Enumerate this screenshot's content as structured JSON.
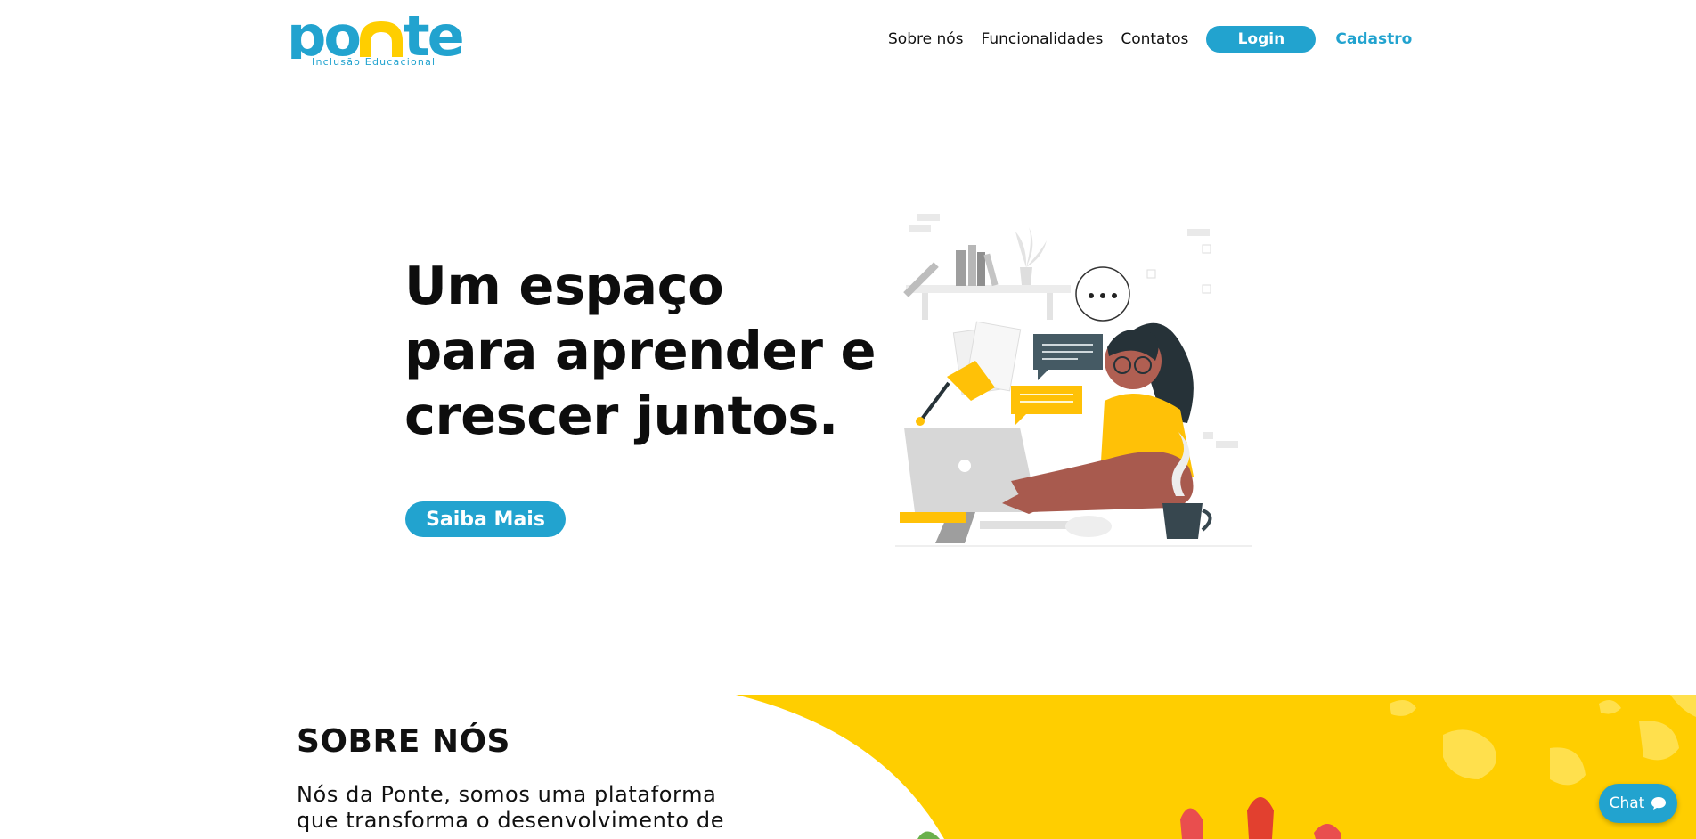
{
  "header": {
    "logo_text": "ponte",
    "logo_subtitle": "Inclusão Educacional",
    "nav": {
      "sobre": "Sobre nós",
      "funcionalidades": "Funcionalidades",
      "contatos": "Contatos",
      "login": "Login",
      "cadastro": "Cadastro"
    }
  },
  "hero": {
    "title_lines": [
      "Um espaço",
      "para aprender e",
      "crescer juntos."
    ],
    "cta": "Saiba Mais",
    "illustration": "woman-at-computer-illustration"
  },
  "about": {
    "title": "SOBRE NÓS",
    "text_lines": [
      "Nós da Ponte, somos uma plataforma",
      "que transforma o desenvolvimento de"
    ]
  },
  "chat": {
    "label": "Chat",
    "icon": "chat-bubble-icon"
  },
  "colors": {
    "primary": "#22a3cf",
    "accent": "#ffce00",
    "text": "#111111"
  }
}
